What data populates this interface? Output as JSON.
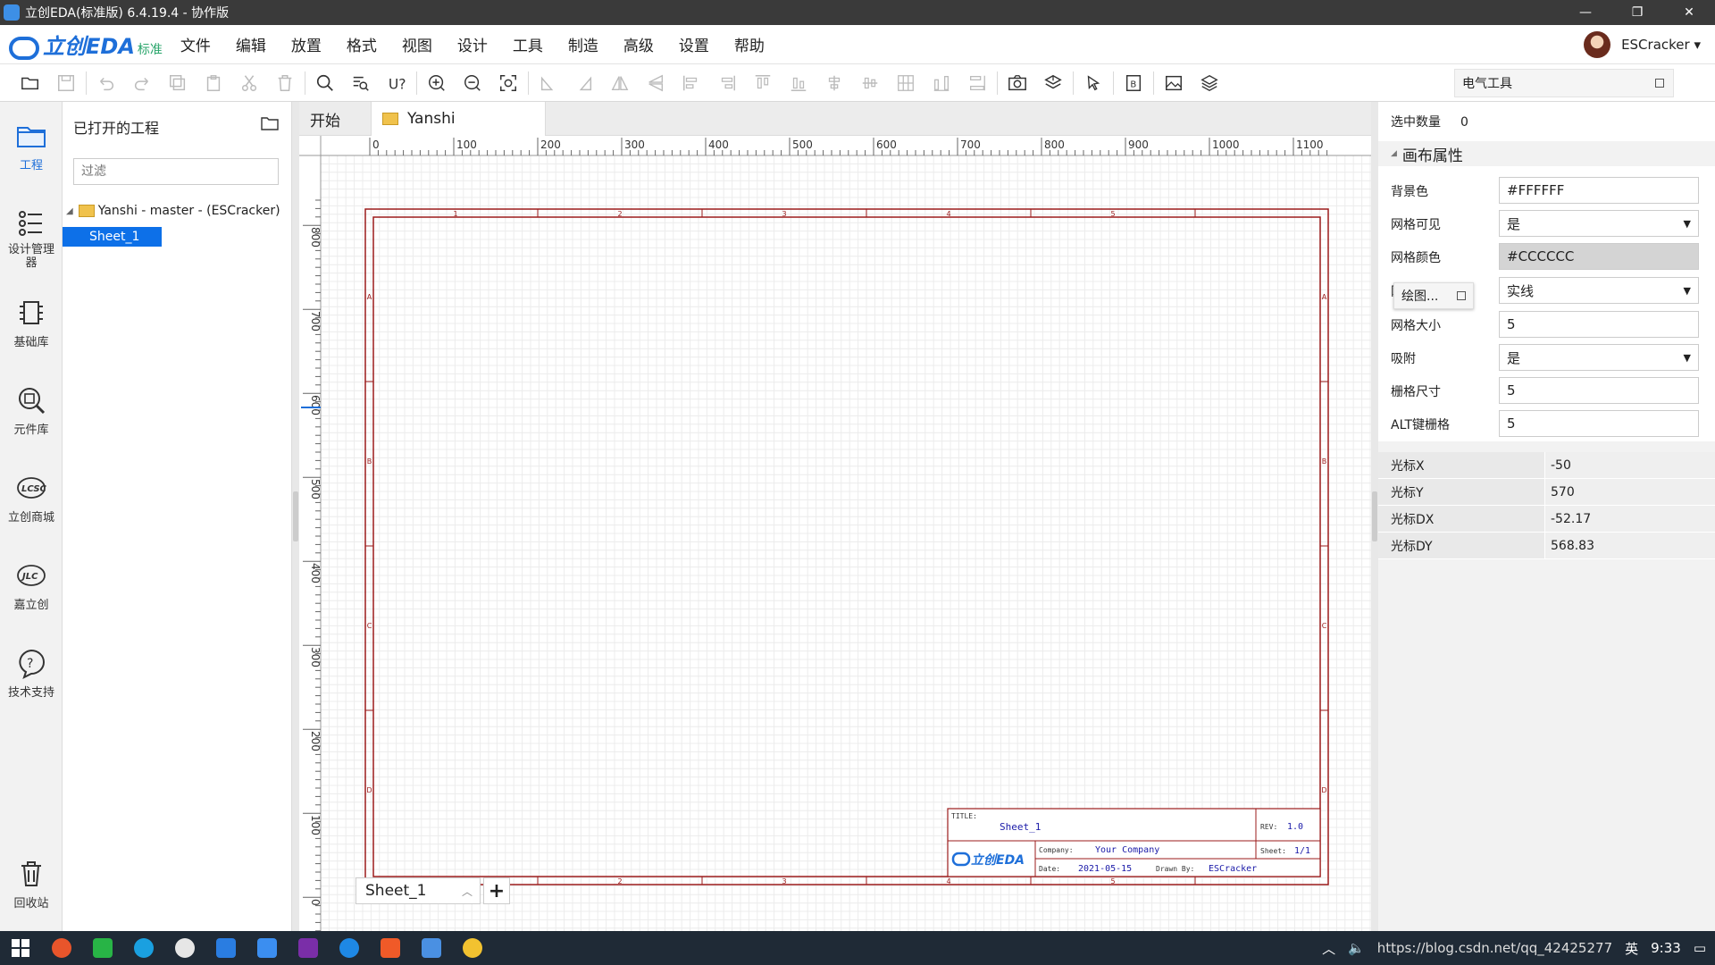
{
  "window": {
    "title": "立创EDA(标准版) 6.4.19.4 - 协作版",
    "min": "—",
    "max": "❐",
    "close": "✕"
  },
  "menubar": {
    "brand": "立创EDA",
    "edition": "标准",
    "items": [
      "文件",
      "编辑",
      "放置",
      "格式",
      "视图",
      "设计",
      "工具",
      "制造",
      "高级",
      "设置",
      "帮助"
    ],
    "user": "ESCracker ▾"
  },
  "toolbar": {
    "electrical_tools": "电气工具"
  },
  "rail": {
    "items": [
      {
        "label": "工程"
      },
      {
        "label": "设计管理器"
      },
      {
        "label": "基础库"
      },
      {
        "label": "元件库"
      },
      {
        "label": "立创商城"
      },
      {
        "label": "嘉立创"
      },
      {
        "label": "技术支持"
      },
      {
        "label": "回收站"
      }
    ]
  },
  "project_panel": {
    "title": "已打开的工程",
    "filter_placeholder": "过滤",
    "root": "Yanshi - master - (ESCracker)",
    "sheet": "Sheet_1"
  },
  "tabs": {
    "home": "开始",
    "active": "Yanshi"
  },
  "canvas": {
    "ruler_x": [
      "0",
      "100",
      "200",
      "300",
      "400",
      "500",
      "600",
      "700",
      "800",
      "900",
      "1000",
      "1100"
    ],
    "ruler_y": [
      "800",
      "700",
      "600",
      "500",
      "400",
      "300",
      "200",
      "100",
      "0"
    ],
    "frame_cols": [
      "1",
      "2",
      "3",
      "4",
      "5"
    ],
    "frame_rows": [
      "A",
      "B",
      "C",
      "D"
    ],
    "titleblock": {
      "title_label": "TITLE:",
      "title_value": "Sheet_1",
      "rev_label": "REV:",
      "rev_value": "1.0",
      "company_label": "Company:",
      "company_value": "Your Company",
      "sheet_label": "Sheet:",
      "sheet_value": "1/1",
      "date_label": "Date:",
      "date_value": "2021-05-15",
      "drawn_label": "Drawn By:",
      "drawn_value": "ESCracker",
      "logo": "立创EDA"
    },
    "sheet_tab": "Sheet_1",
    "sheet_add": "+",
    "sheet_up": "^"
  },
  "properties": {
    "selected_label": "选中数量",
    "selected_value": "0",
    "section": "画布属性",
    "rows": [
      {
        "label": "背景色",
        "value": "#FFFFFF"
      },
      {
        "label": "网格可见",
        "value": "是"
      },
      {
        "label": "网格颜色",
        "value": "#CCCCCC"
      },
      {
        "label": "网",
        "value": "实线"
      },
      {
        "label": "网格大小",
        "value": "5"
      },
      {
        "label": "吸附",
        "value": "是"
      },
      {
        "label": "栅格尺寸",
        "value": "5"
      },
      {
        "label": "ALT键栅格",
        "value": "5"
      }
    ],
    "popup": "绘图...",
    "cursor": [
      {
        "label": "光标X",
        "value": "-50"
      },
      {
        "label": "光标Y",
        "value": "570"
      },
      {
        "label": "光标DX",
        "value": "-52.17"
      },
      {
        "label": "光标DY",
        "value": "568.83"
      }
    ]
  },
  "taskbar": {
    "tray_text": "https://blog.csdn.net/qq_42425277",
    "ime": "英",
    "time": "9:33"
  },
  "colors": {
    "accent": "#1e6fd9",
    "frame": "#9b1b1b",
    "selection": "#0d70e8"
  }
}
